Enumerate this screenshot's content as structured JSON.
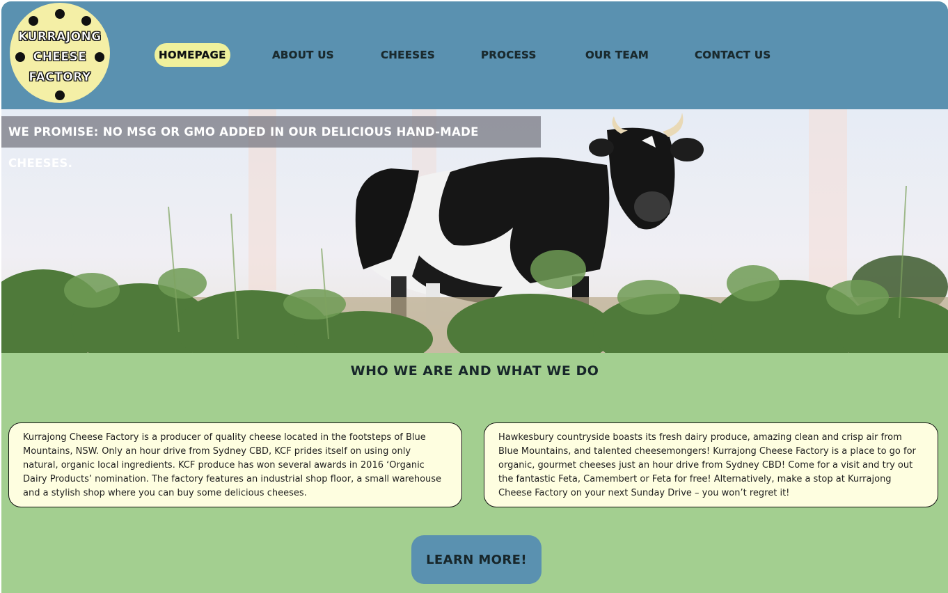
{
  "brand": {
    "logo_lines": [
      "KURRAJONG",
      "CHEESE",
      "FACTORY"
    ]
  },
  "nav": {
    "items": [
      {
        "label": "HOMEPAGE",
        "active": true
      },
      {
        "label": "ABOUT US",
        "active": false
      },
      {
        "label": "CHEESES",
        "active": false
      },
      {
        "label": "PROCESS",
        "active": false
      },
      {
        "label": "OUR TEAM",
        "active": false
      },
      {
        "label": "CONTACT US",
        "active": false
      }
    ]
  },
  "hero": {
    "promise": "WE PROMISE: NO MSG OR GMO ADDED IN OUR DELICIOUS HAND-MADE CHEESES.",
    "image": "cow-in-field"
  },
  "main": {
    "title": "WHO WE ARE AND WHAT WE DO",
    "cards": [
      "Kurrajong Cheese Factory is a producer of quality cheese located in the footsteps of Blue Mountains, NSW. Only an hour drive from Sydney CBD, KCF prides itself on using only natural, organic local ingredients. KCF produce has won several awards in 2016 ‘Organic Dairy Products’ nomination. The factory features an industrial shop floor, a small warehouse and a stylish shop where you can buy some delicious cheeses.",
      "Hawkesbury countryside boasts its fresh dairy produce, amazing clean and crisp air from Blue Mountains, and talented cheesemongers! Kurrajong Cheese Factory is a place to go for organic, gourmet cheeses just an hour drive from Sydney CBD! Come for a visit and try out the fantastic Feta, Camembert or Feta for free! Alternatively, make a stop at Kurrajong Cheese Factory on your next Sunday Drive – you won’t regret it!"
    ],
    "cta_label": "LEARN MORE!"
  },
  "colors": {
    "header": "#5a91b0",
    "logo_bg": "#f4efa6",
    "active_nav": "#f0f19c",
    "page_bg": "#a3cf90",
    "card_bg": "#fefee0"
  }
}
